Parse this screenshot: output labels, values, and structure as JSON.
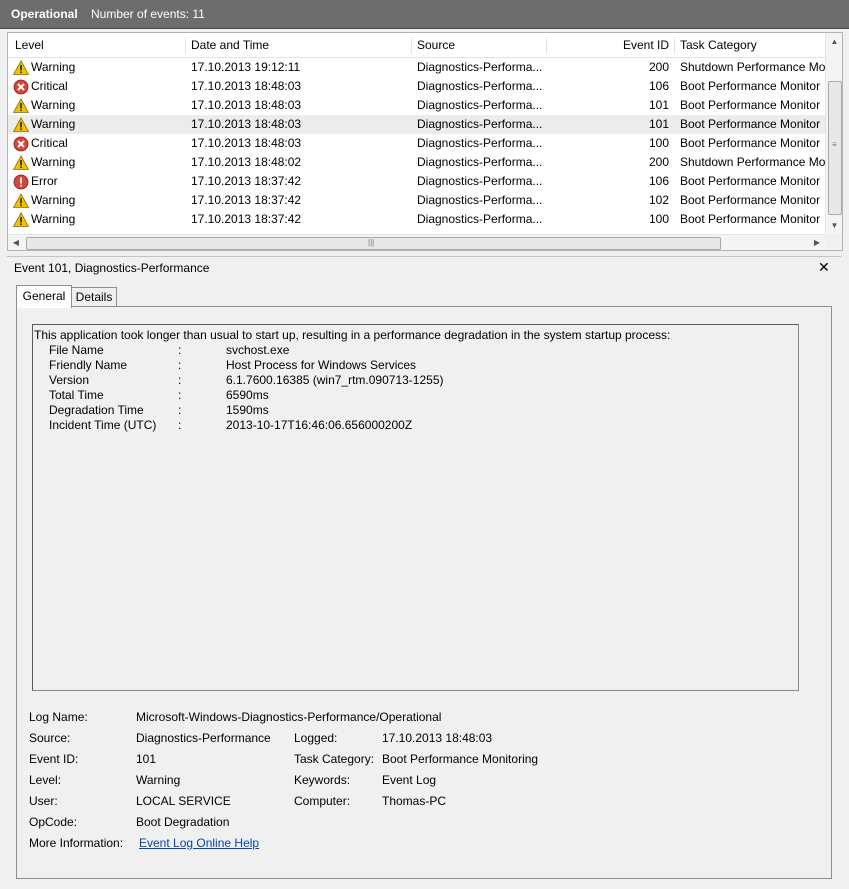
{
  "header": {
    "title": "Operational",
    "count_text": "Number of events: 11"
  },
  "columns": [
    "Level",
    "Date and Time",
    "Source",
    "Event ID",
    "Task Category"
  ],
  "events": [
    {
      "level": "Warning",
      "icon": "warning-icon",
      "date": "17.10.2013 19:12:11",
      "source": "Diagnostics-Performa...",
      "id": "200",
      "category": "Shutdown Performance Mo"
    },
    {
      "level": "Critical",
      "icon": "critical-icon",
      "date": "17.10.2013 18:48:03",
      "source": "Diagnostics-Performa...",
      "id": "106",
      "category": "Boot Performance Monitor"
    },
    {
      "level": "Warning",
      "icon": "warning-icon",
      "date": "17.10.2013 18:48:03",
      "source": "Diagnostics-Performa...",
      "id": "101",
      "category": "Boot Performance Monitor"
    },
    {
      "level": "Warning",
      "icon": "warning-icon",
      "date": "17.10.2013 18:48:03",
      "source": "Diagnostics-Performa...",
      "id": "101",
      "category": "Boot Performance Monitor"
    },
    {
      "level": "Critical",
      "icon": "critical-icon",
      "date": "17.10.2013 18:48:03",
      "source": "Diagnostics-Performa...",
      "id": "100",
      "category": "Boot Performance Monitor"
    },
    {
      "level": "Warning",
      "icon": "warning-icon",
      "date": "17.10.2013 18:48:02",
      "source": "Diagnostics-Performa...",
      "id": "200",
      "category": "Shutdown Performance Mo"
    },
    {
      "level": "Error",
      "icon": "error-icon",
      "date": "17.10.2013 18:37:42",
      "source": "Diagnostics-Performa...",
      "id": "106",
      "category": "Boot Performance Monitor"
    },
    {
      "level": "Warning",
      "icon": "warning-icon",
      "date": "17.10.2013 18:37:42",
      "source": "Diagnostics-Performa...",
      "id": "102",
      "category": "Boot Performance Monitor"
    },
    {
      "level": "Warning",
      "icon": "warning-icon",
      "date": "17.10.2013 18:37:42",
      "source": "Diagnostics-Performa...",
      "id": "100",
      "category": "Boot Performance Monitor"
    }
  ],
  "detail": {
    "title": "Event 101, Diagnostics-Performance",
    "tabs": {
      "general": "General",
      "details": "Details"
    },
    "description": {
      "intro": "This application took longer than usual to start up, resulting in a performance degradation in the system startup process:",
      "fields": [
        {
          "label": "File Name",
          "value": "svchost.exe"
        },
        {
          "label": "Friendly Name",
          "value": "Host Process for Windows Services"
        },
        {
          "label": "Version",
          "value": "6.1.7600.16385 (win7_rtm.090713-1255)"
        },
        {
          "label": "Total Time",
          "value": "6590ms"
        },
        {
          "label": "Degradation Time",
          "value": "1590ms"
        },
        {
          "label": "Incident Time (UTC)",
          "value": "2013-10-17T16:46:06.656000200Z"
        }
      ]
    },
    "meta": {
      "log_name_label": "Log Name:",
      "log_name": "Microsoft-Windows-Diagnostics-Performance/Operational",
      "source_label": "Source:",
      "source": "Diagnostics-Performance",
      "logged_label": "Logged:",
      "logged": "17.10.2013 18:48:03",
      "event_id_label": "Event ID:",
      "event_id": "101",
      "task_category_label": "Task Category:",
      "task_category": "Boot Performance Monitoring",
      "level_label": "Level:",
      "level": "Warning",
      "keywords_label": "Keywords:",
      "keywords": "Event Log",
      "user_label": "User:",
      "user": "LOCAL SERVICE",
      "computer_label": "Computer:",
      "computer": "Thomas-PC",
      "opcode_label": "OpCode:",
      "opcode": "Boot Degradation",
      "more_info_label": "More Information:",
      "more_info_link": "Event Log Online Help"
    }
  },
  "colors": {
    "titlebar": "#6d6d6d",
    "selected_row": "#ececec",
    "link": "#0645ad",
    "warning": "#f2c200",
    "critical": "#d9443a"
  }
}
